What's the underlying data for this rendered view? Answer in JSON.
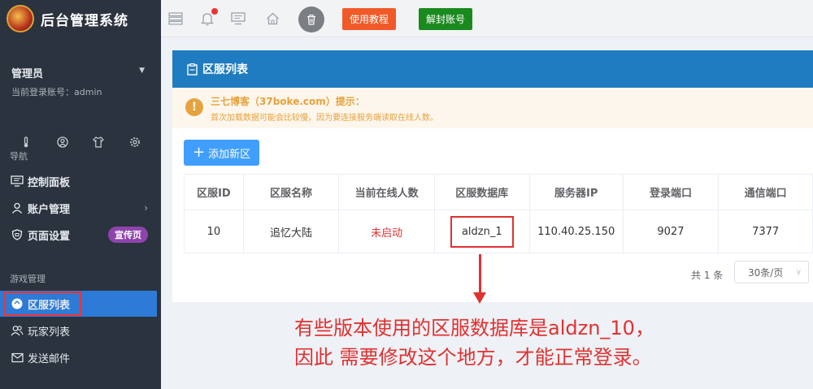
{
  "app": {
    "title": "后台管理系统"
  },
  "user": {
    "role": "管理员",
    "login_prefix": "当前登录账号：",
    "account": "admin"
  },
  "quick_icons": [
    "thermometer-icon",
    "user-circle-icon",
    "shirt-icon",
    "gear-icon"
  ],
  "sidebar": {
    "nav_section": "导航",
    "nav_items": [
      {
        "label": "控制面板",
        "icon": "monitor-icon"
      },
      {
        "label": "账户管理",
        "icon": "user-icon"
      },
      {
        "label": "页面设置",
        "icon": "shield-icon",
        "badge": "宣传页"
      }
    ],
    "game_section": "游戏管理",
    "game_items": [
      {
        "label": "区服列表",
        "icon": "server-icon",
        "active": true
      },
      {
        "label": "玩家列表",
        "icon": "users-icon"
      },
      {
        "label": "发送邮件",
        "icon": "mail-icon"
      }
    ]
  },
  "topbar": {
    "icons": [
      "menu-icon",
      "bell-icon",
      "screen-icon",
      "home-icon",
      "trash-icon"
    ],
    "tutorial_label": "使用教程",
    "unban_label": "解封账号"
  },
  "colors": {
    "accent": "#1f7cc1",
    "sidebar": "#2b333e",
    "orange": "#f05a28",
    "green": "#1a8a1f",
    "annotation": "#e03131"
  },
  "panel": {
    "title": "区服列表",
    "notice_title": "三七博客（37boke.com）提示：",
    "notice_text": "首次加载数据可能会比较慢，因为要连接服务端读取在线人数。",
    "add_label": "添加新区"
  },
  "table": {
    "headers": [
      "区服ID",
      "区服名称",
      "当前在线人数",
      "区服数据库",
      "服务器IP",
      "登录端口",
      "通信端口"
    ],
    "rows": [
      {
        "id": "10",
        "name": "追忆大陆",
        "online": "未启动",
        "db": "aldzn_1",
        "ip": "110.40.25.150",
        "login_port": "9027",
        "comm_port": "7377"
      }
    ]
  },
  "pager": {
    "total": "共 1 条",
    "page_size": "30条/页"
  },
  "annotation": {
    "line1": "有些版本使用的区服数据库是aldzn_10，",
    "line2": "因此 需要修改这个地方，才能正常登录。"
  }
}
